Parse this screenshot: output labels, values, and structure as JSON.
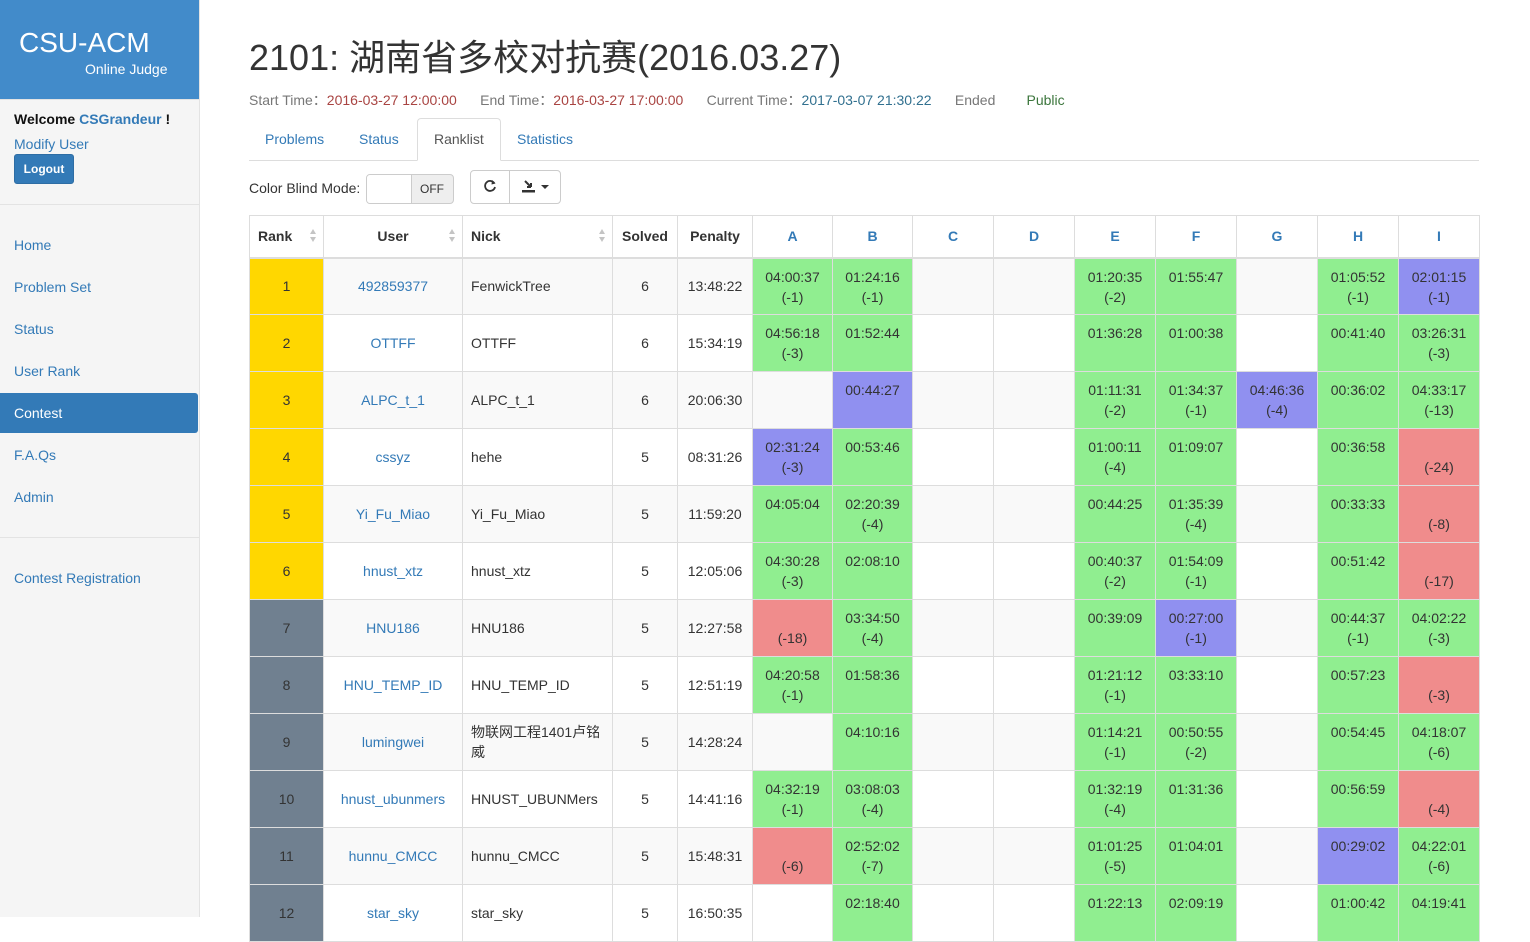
{
  "brand": {
    "title": "CSU-ACM",
    "subtitle": "Online Judge"
  },
  "account": {
    "welcome": "Welcome",
    "username": "CSGrandeur",
    "suffix": " !",
    "modify": "Modify User",
    "logout": "Logout"
  },
  "nav": [
    "Home",
    "Problem Set",
    "Status",
    "User Rank",
    "Contest",
    "F.A.Qs",
    "Admin"
  ],
  "nav_active": "Contest",
  "contest_registration": "Contest Registration",
  "contest": {
    "title": "2101: 湖南省多校对抗赛(2016.03.27)",
    "start_label": "Start Time：",
    "start": "2016-03-27 12:00:00",
    "end_label": "End Time：",
    "end": "2016-03-27 17:00:00",
    "current_label": "Current Time：",
    "current": "2017-03-07 21:30:22",
    "status": "Ended",
    "visibility": "Public"
  },
  "tabs": [
    "Problems",
    "Status",
    "Ranklist",
    "Statistics"
  ],
  "active_tab": "Ranklist",
  "color_blind": {
    "label": "Color Blind Mode:",
    "state": "OFF"
  },
  "icons": {
    "refresh": "refresh-icon",
    "export": "download-icon"
  },
  "colors": {
    "accepted": "#90ee90",
    "first_blood": "#9090f0",
    "wrong": "#f08c8c",
    "gold": "#ffd700",
    "gray": "#708090"
  },
  "table": {
    "headers": [
      "Rank",
      "User",
      "Nick",
      "Solved",
      "Penalty"
    ],
    "problems": [
      "A",
      "B",
      "C",
      "D",
      "E",
      "F",
      "G",
      "H",
      "I"
    ],
    "rows": [
      {
        "rank": "1",
        "medal": "gold",
        "user": "492859377",
        "nick": "FenwickTree",
        "solved": "6",
        "penalty": "13:48:22",
        "cells": [
          {
            "s": "ac",
            "t": "04:00:37",
            "p": "(-1)"
          },
          {
            "s": "ac",
            "t": "01:24:16",
            "p": "(-1)"
          },
          null,
          null,
          {
            "s": "ac",
            "t": "01:20:35",
            "p": "(-2)"
          },
          {
            "s": "ac",
            "t": "01:55:47",
            "p": ""
          },
          null,
          {
            "s": "ac",
            "t": "01:05:52",
            "p": "(-1)"
          },
          {
            "s": "fb",
            "t": "02:01:15",
            "p": "(-1)"
          }
        ]
      },
      {
        "rank": "2",
        "medal": "gold",
        "user": "OTTFF",
        "nick": "OTTFF",
        "solved": "6",
        "penalty": "15:34:19",
        "cells": [
          {
            "s": "ac",
            "t": "04:56:18",
            "p": "(-3)"
          },
          {
            "s": "ac",
            "t": "01:52:44",
            "p": ""
          },
          null,
          null,
          {
            "s": "ac",
            "t": "01:36:28",
            "p": ""
          },
          {
            "s": "ac",
            "t": "01:00:38",
            "p": ""
          },
          null,
          {
            "s": "ac",
            "t": "00:41:40",
            "p": ""
          },
          {
            "s": "ac",
            "t": "03:26:31",
            "p": "(-3)"
          }
        ]
      },
      {
        "rank": "3",
        "medal": "gold",
        "user": "ALPC_t_1",
        "nick": "ALPC_t_1",
        "solved": "6",
        "penalty": "20:06:30",
        "cells": [
          null,
          {
            "s": "fb",
            "t": "00:44:27",
            "p": ""
          },
          null,
          null,
          {
            "s": "ac",
            "t": "01:11:31",
            "p": "(-2)"
          },
          {
            "s": "ac",
            "t": "01:34:37",
            "p": "(-1)"
          },
          {
            "s": "fb",
            "t": "04:46:36",
            "p": "(-4)"
          },
          {
            "s": "ac",
            "t": "00:36:02",
            "p": ""
          },
          {
            "s": "ac",
            "t": "04:33:17",
            "p": "(-13)"
          }
        ]
      },
      {
        "rank": "4",
        "medal": "gold",
        "user": "cssyz",
        "nick": "hehe",
        "solved": "5",
        "penalty": "08:31:26",
        "cells": [
          {
            "s": "fb",
            "t": "02:31:24",
            "p": "(-3)"
          },
          {
            "s": "ac",
            "t": "00:53:46",
            "p": ""
          },
          null,
          null,
          {
            "s": "ac",
            "t": "01:00:11",
            "p": "(-4)"
          },
          {
            "s": "ac",
            "t": "01:09:07",
            "p": ""
          },
          null,
          {
            "s": "ac",
            "t": "00:36:58",
            "p": ""
          },
          {
            "s": "wa",
            "t": "",
            "p": "(-24)"
          }
        ]
      },
      {
        "rank": "5",
        "medal": "gold",
        "user": "Yi_Fu_Miao",
        "nick": "Yi_Fu_Miao",
        "solved": "5",
        "penalty": "11:59:20",
        "cells": [
          {
            "s": "ac",
            "t": "04:05:04",
            "p": ""
          },
          {
            "s": "ac",
            "t": "02:20:39",
            "p": "(-4)"
          },
          null,
          null,
          {
            "s": "ac",
            "t": "00:44:25",
            "p": ""
          },
          {
            "s": "ac",
            "t": "01:35:39",
            "p": "(-4)"
          },
          null,
          {
            "s": "ac",
            "t": "00:33:33",
            "p": ""
          },
          {
            "s": "wa",
            "t": "",
            "p": "(-8)"
          }
        ]
      },
      {
        "rank": "6",
        "medal": "gold",
        "user": "hnust_xtz",
        "nick": "hnust_xtz",
        "solved": "5",
        "penalty": "12:05:06",
        "cells": [
          {
            "s": "ac",
            "t": "04:30:28",
            "p": "(-3)"
          },
          {
            "s": "ac",
            "t": "02:08:10",
            "p": ""
          },
          null,
          null,
          {
            "s": "ac",
            "t": "00:40:37",
            "p": "(-2)"
          },
          {
            "s": "ac",
            "t": "01:54:09",
            "p": "(-1)"
          },
          null,
          {
            "s": "ac",
            "t": "00:51:42",
            "p": ""
          },
          {
            "s": "wa",
            "t": "",
            "p": "(-17)"
          }
        ]
      },
      {
        "rank": "7",
        "medal": "gray",
        "user": "HNU186",
        "nick": "HNU186",
        "solved": "5",
        "penalty": "12:27:58",
        "cells": [
          {
            "s": "wa",
            "t": "",
            "p": "(-18)"
          },
          {
            "s": "ac",
            "t": "03:34:50",
            "p": "(-4)"
          },
          null,
          null,
          {
            "s": "ac",
            "t": "00:39:09",
            "p": ""
          },
          {
            "s": "fb",
            "t": "00:27:00",
            "p": "(-1)"
          },
          null,
          {
            "s": "ac",
            "t": "00:44:37",
            "p": "(-1)"
          },
          {
            "s": "ac",
            "t": "04:02:22",
            "p": "(-3)"
          }
        ]
      },
      {
        "rank": "8",
        "medal": "gray",
        "user": "HNU_TEMP_ID",
        "nick": "HNU_TEMP_ID",
        "solved": "5",
        "penalty": "12:51:19",
        "cells": [
          {
            "s": "ac",
            "t": "04:20:58",
            "p": "(-1)"
          },
          {
            "s": "ac",
            "t": "01:58:36",
            "p": ""
          },
          null,
          null,
          {
            "s": "ac",
            "t": "01:21:12",
            "p": "(-1)"
          },
          {
            "s": "ac",
            "t": "03:33:10",
            "p": ""
          },
          null,
          {
            "s": "ac",
            "t": "00:57:23",
            "p": ""
          },
          {
            "s": "wa",
            "t": "",
            "p": "(-3)"
          }
        ]
      },
      {
        "rank": "9",
        "medal": "gray",
        "user": "lumingwei",
        "nick": "物联网工程1401卢铭威",
        "solved": "5",
        "penalty": "14:28:24",
        "cells": [
          null,
          {
            "s": "ac",
            "t": "04:10:16",
            "p": ""
          },
          null,
          null,
          {
            "s": "ac",
            "t": "01:14:21",
            "p": "(-1)"
          },
          {
            "s": "ac",
            "t": "00:50:55",
            "p": "(-2)"
          },
          null,
          {
            "s": "ac",
            "t": "00:54:45",
            "p": ""
          },
          {
            "s": "ac",
            "t": "04:18:07",
            "p": "(-6)"
          }
        ]
      },
      {
        "rank": "10",
        "medal": "gray",
        "user": "hnust_ubunmers",
        "nick": "HNUST_UBUNMers",
        "solved": "5",
        "penalty": "14:41:16",
        "cells": [
          {
            "s": "ac",
            "t": "04:32:19",
            "p": "(-1)"
          },
          {
            "s": "ac",
            "t": "03:08:03",
            "p": "(-4)"
          },
          null,
          null,
          {
            "s": "ac",
            "t": "01:32:19",
            "p": "(-4)"
          },
          {
            "s": "ac",
            "t": "01:31:36",
            "p": ""
          },
          null,
          {
            "s": "ac",
            "t": "00:56:59",
            "p": ""
          },
          {
            "s": "wa",
            "t": "",
            "p": "(-4)"
          }
        ]
      },
      {
        "rank": "11",
        "medal": "gray",
        "user": "hunnu_CMCC",
        "nick": "hunnu_CMCC",
        "solved": "5",
        "penalty": "15:48:31",
        "cells": [
          {
            "s": "wa",
            "t": "",
            "p": "(-6)"
          },
          {
            "s": "ac",
            "t": "02:52:02",
            "p": "(-7)"
          },
          null,
          null,
          {
            "s": "ac",
            "t": "01:01:25",
            "p": "(-5)"
          },
          {
            "s": "ac",
            "t": "01:04:01",
            "p": ""
          },
          null,
          {
            "s": "fb",
            "t": "00:29:02",
            "p": ""
          },
          {
            "s": "ac",
            "t": "04:22:01",
            "p": "(-6)"
          }
        ]
      },
      {
        "rank": "12",
        "medal": "gray",
        "user": "star_sky",
        "nick": "star_sky",
        "solved": "5",
        "penalty": "16:50:35",
        "cells": [
          null,
          {
            "s": "ac",
            "t": "02:18:40",
            "p": ""
          },
          null,
          null,
          {
            "s": "ac",
            "t": "01:22:13",
            "p": ""
          },
          {
            "s": "ac",
            "t": "02:09:19",
            "p": ""
          },
          null,
          {
            "s": "ac",
            "t": "01:00:42",
            "p": ""
          },
          {
            "s": "ac",
            "t": "04:19:41",
            "p": ""
          }
        ]
      }
    ]
  }
}
